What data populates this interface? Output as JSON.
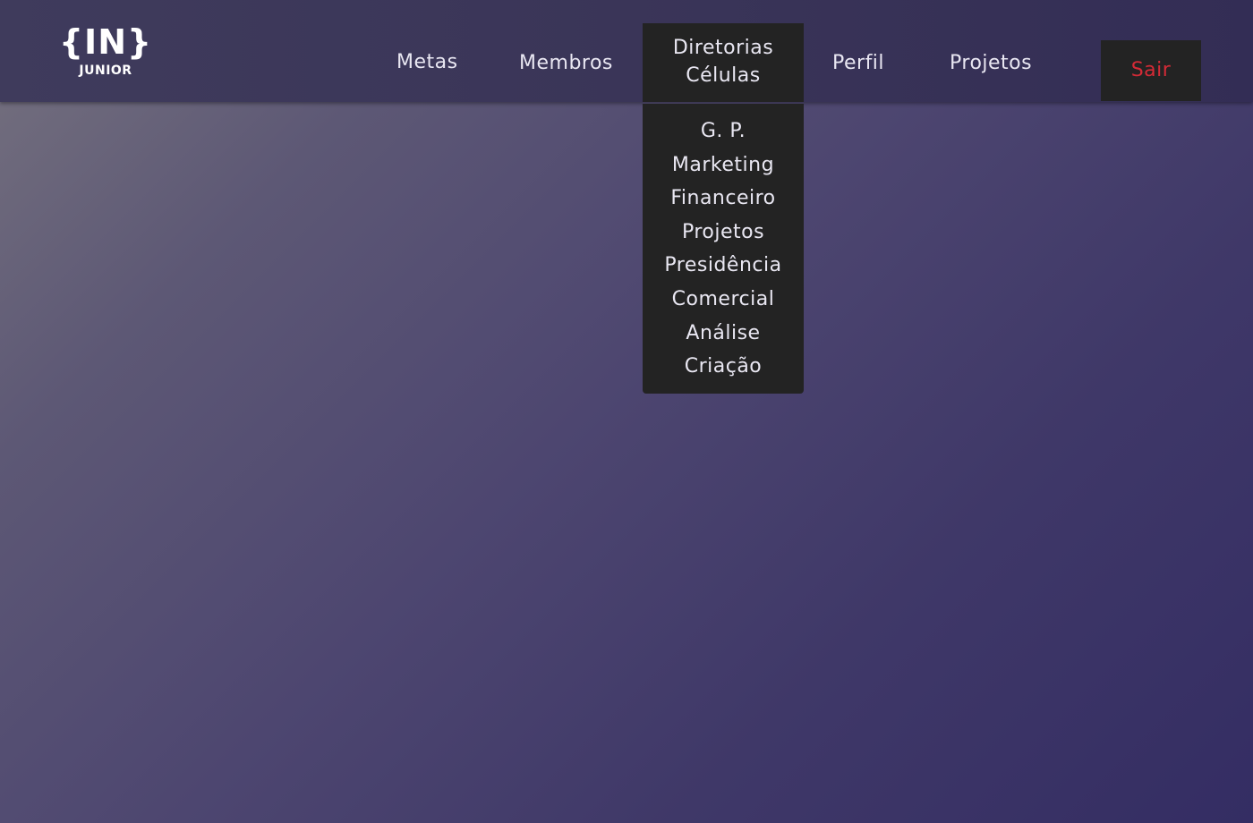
{
  "logo": {
    "main": "{IN}",
    "sub": "JUNIOR"
  },
  "nav": {
    "metas": "Metas",
    "membros": "Membros",
    "diretorias_label": "Diretorias",
    "celulas_label": "Células",
    "perfil": "Perfil",
    "projetos": "Projetos",
    "logout": "Sair"
  },
  "dropdown": {
    "items": [
      "G. P.",
      "Marketing",
      "Financeiro",
      "Projetos",
      "Presidência",
      "Comercial",
      "Análise",
      "Criação"
    ]
  },
  "colors": {
    "navbar": "#3a3558",
    "dropdown_bg": "#232323",
    "logout_text": "#d42a36",
    "nav_text": "#e9e7f2"
  }
}
